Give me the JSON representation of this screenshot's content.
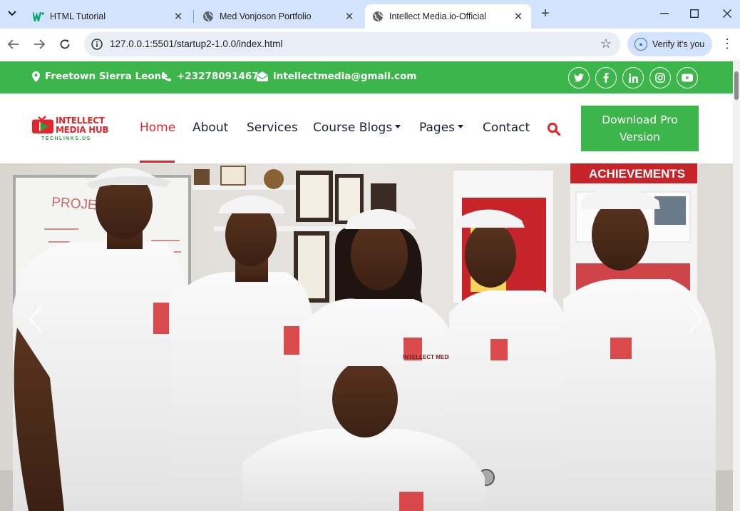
{
  "browser": {
    "tabs": [
      {
        "title": "HTML Tutorial",
        "favicon": "w3schools-icon",
        "active": false
      },
      {
        "title": "Med Vonjoson Portfolio",
        "favicon": "globe-icon",
        "active": false
      },
      {
        "title": "Intellect Media.io-Official",
        "favicon": "globe-icon",
        "active": true
      }
    ],
    "url": "127.0.0.1:5501/startup2-1.0.0/index.html",
    "verify_label": "Verify it's you"
  },
  "topbar": {
    "location": "Freetown Sierra Leone",
    "phone": "+23278091467",
    "email": "intellectmedia@gmail.com",
    "social": [
      "twitter-icon",
      "facebook-icon",
      "linkedin-icon",
      "instagram-icon",
      "youtube-icon"
    ],
    "color": "#3cb54b"
  },
  "brand": {
    "line1": "INTELLECT",
    "line2": "MEDIA HUB",
    "tagline": "TECHLINKS.US"
  },
  "nav": {
    "items": [
      {
        "label": "Home",
        "active": true
      },
      {
        "label": "About"
      },
      {
        "label": "Services"
      },
      {
        "label": "Course Blogs",
        "dropdown": true
      },
      {
        "label": "Pages",
        "dropdown": true
      },
      {
        "label": "Contact"
      }
    ],
    "cta": "Download Pro Version",
    "accent": "#e2262b"
  },
  "hero": {
    "board_text": "PROJEC",
    "banner_text": "ACHIEVEMENTS",
    "shirt_print": "INTELLECT MEDIA"
  }
}
